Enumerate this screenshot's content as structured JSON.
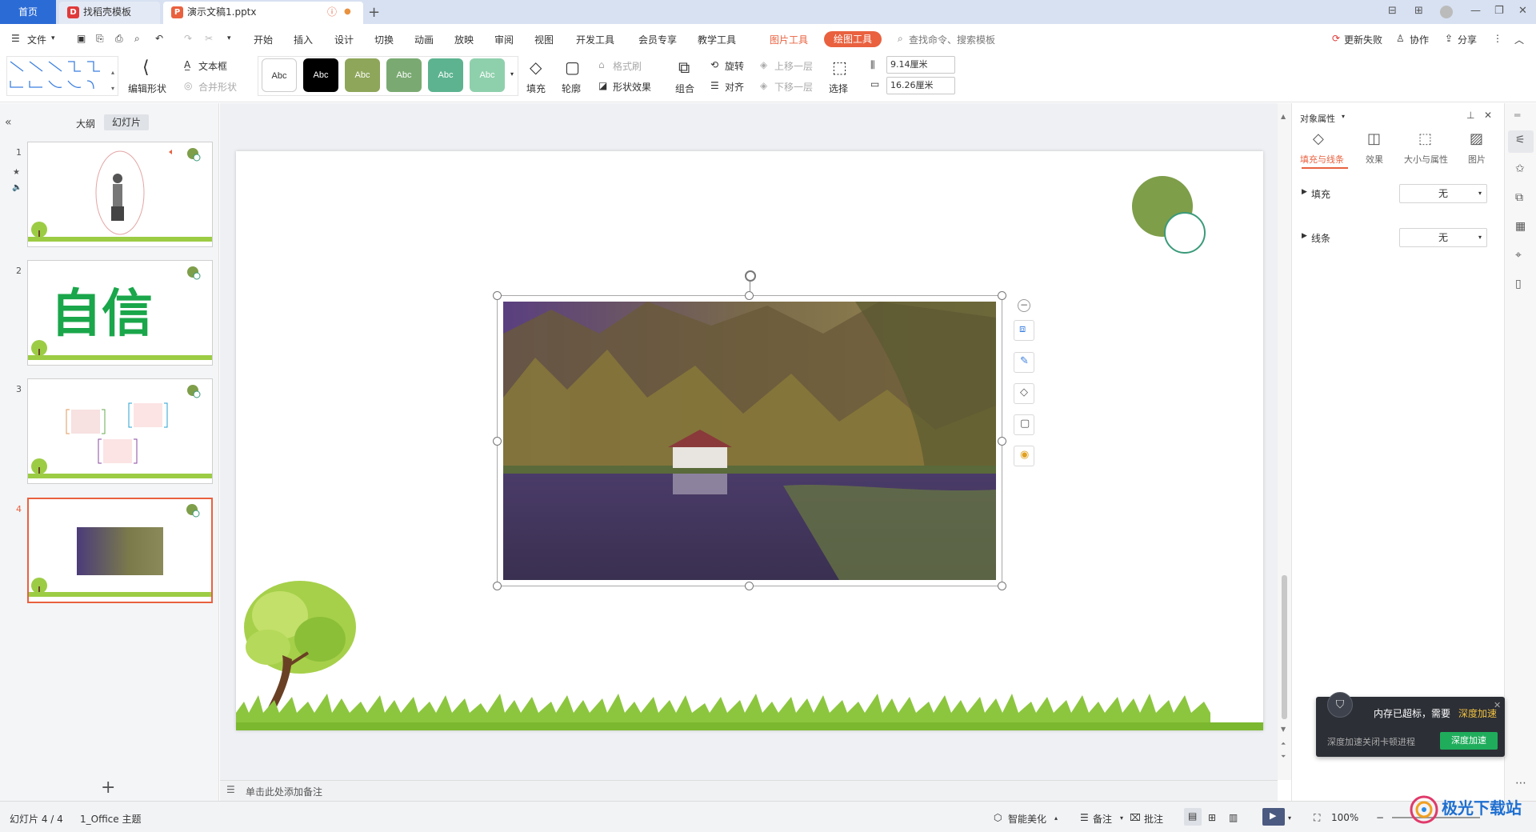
{
  "tabs": {
    "home": "首页",
    "docer": "找稻壳模板",
    "doc": "演示文稿1.pptx"
  },
  "menubar": {
    "file": "文件",
    "items": [
      "开始",
      "插入",
      "设计",
      "切换",
      "动画",
      "放映",
      "审阅",
      "视图",
      "开发工具",
      "会员专享",
      "教学工具"
    ],
    "picture_tools": "图片工具",
    "drawing_tools": "绘图工具",
    "search_placeholder": "查找命令、搜索模板",
    "update_failed": "更新失败",
    "collaborate": "协作",
    "share": "分享"
  },
  "ribbon": {
    "edit_shape": "编辑形状",
    "text_box": "文本框",
    "merge_shape": "合并形状",
    "style_label": "Abc",
    "fill": "填充",
    "outline": "轮廓",
    "format_painter": "格式刷",
    "shape_effects": "形状效果",
    "group": "组合",
    "rotate": "旋转",
    "align": "对齐",
    "bring_forward": "上移一层",
    "send_backward": "下移一层",
    "select": "选择",
    "height": "9.14厘米",
    "width": "16.26厘米",
    "style_colors": [
      "#ffffff",
      "#000000",
      "#8ea65a",
      "#7aaa72",
      "#5db390",
      "#8fd0ac"
    ]
  },
  "leftpanel": {
    "outline_tab": "大纲",
    "slides_tab": "幻灯片",
    "slide_numbers": [
      "1",
      "2",
      "3",
      "4"
    ],
    "slide2_text": "自信"
  },
  "notes": {
    "placeholder": "单击此处添加备注"
  },
  "rightpanel": {
    "title": "对象属性",
    "tabs": [
      "填充与线条",
      "效果",
      "大小与属性",
      "图片"
    ],
    "fill_label": "填充",
    "fill_value": "无",
    "line_label": "线条",
    "line_value": "无"
  },
  "popup": {
    "message_prefix": "内存已超标，需要",
    "message_link": "深度加速",
    "sub": "深度加速关闭卡顿进程",
    "button": "深度加速"
  },
  "statusbar": {
    "slide_counter": "幻灯片 4 / 4",
    "theme": "1_Office 主题",
    "beautify": "智能美化",
    "notes": "备注",
    "comments": "批注",
    "zoom": "100%"
  },
  "watermark": "极光下载站",
  "accent": "#e9613f",
  "brand_blue": "#2b6bd6"
}
